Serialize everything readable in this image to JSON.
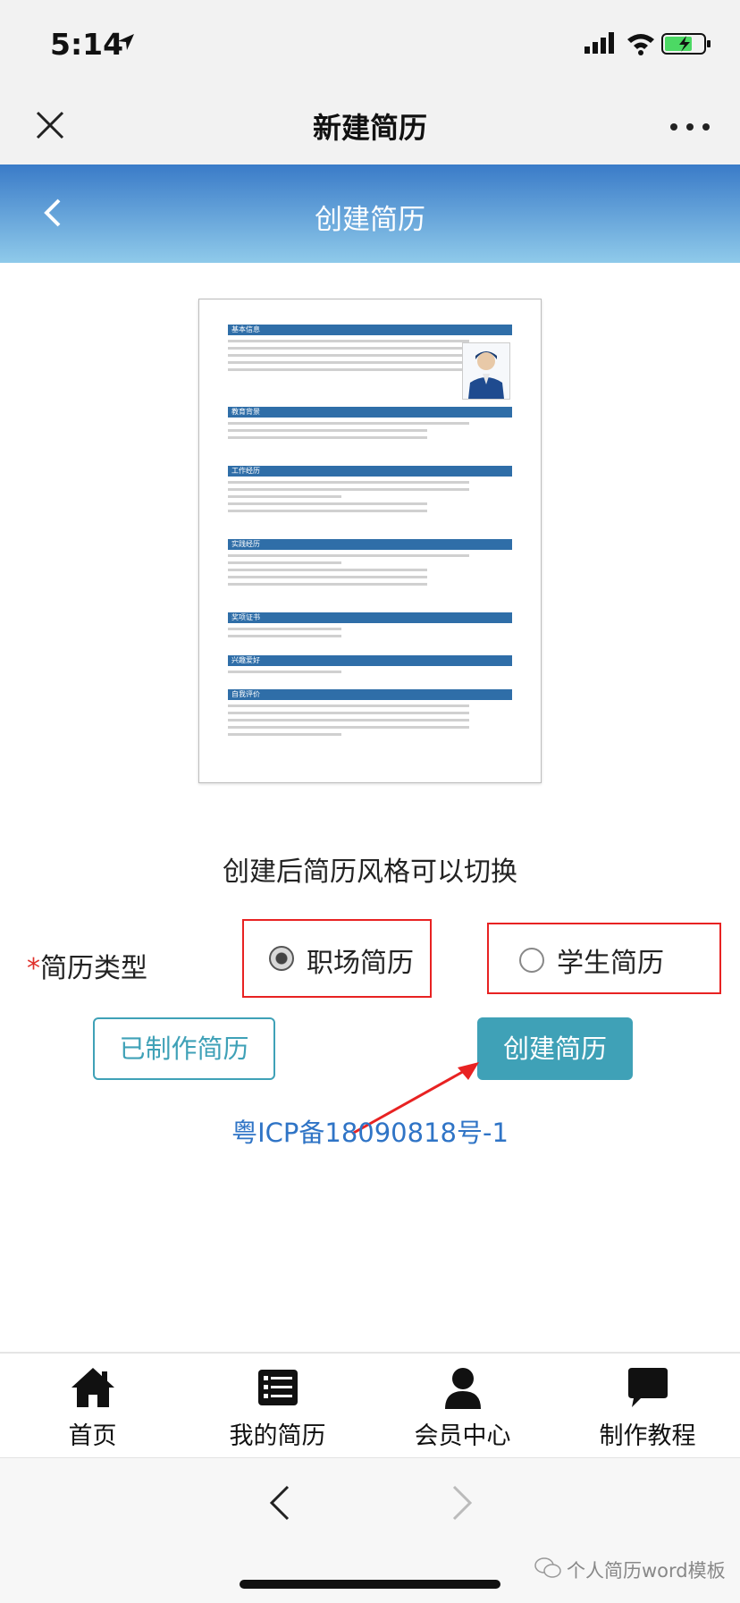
{
  "status": {
    "time": "5:14"
  },
  "wx_header": {
    "title": "新建简历"
  },
  "page_header": {
    "title": "创建简历"
  },
  "resume_preview": {
    "sections": [
      "基本信息",
      "教育背景",
      "工作经历",
      "实践经历",
      "奖项证书",
      "兴趣爱好",
      "自我评价"
    ]
  },
  "hint": "创建后简历风格可以切换",
  "resume_type": {
    "required_mark": "*",
    "label": "简历类型",
    "options": [
      {
        "label": "职场简历",
        "selected": true
      },
      {
        "label": "学生简历",
        "selected": false
      }
    ]
  },
  "buttons": {
    "made": "已制作简历",
    "create": "创建简历"
  },
  "icp": "粤ICP备18090818号-1",
  "tabbar": [
    {
      "label": "首页",
      "icon": "home-icon"
    },
    {
      "label": "我的简历",
      "icon": "list-icon"
    },
    {
      "label": "会员中心",
      "icon": "user-icon"
    },
    {
      "label": "制作教程",
      "icon": "chat-icon"
    }
  ],
  "watermark": "个人简历word模板",
  "colors": {
    "header_blue": "#3a7bc8",
    "accent_teal": "#3fa1b7",
    "link_blue": "#2f74c6",
    "highlight_red": "#e82222"
  }
}
